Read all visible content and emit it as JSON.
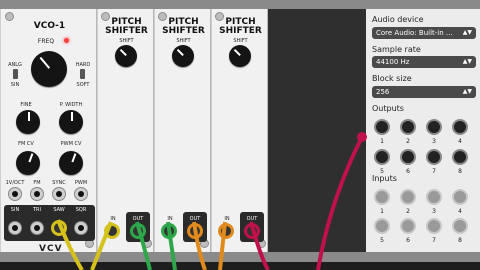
{
  "vco": {
    "title": "VCO-1",
    "freq": "FREQ",
    "anlg": "ANLG",
    "sin": "SIN",
    "hard": "HARD",
    "soft": "SOFT",
    "fine": "FINE",
    "pwidth": "P. WIDTH",
    "fmcv": "FM CV",
    "pwmcv": "PWM CV",
    "in_labels": [
      "1V/OCT",
      "FM",
      "SYNC",
      "PWM"
    ],
    "out_labels": [
      "SIN",
      "TRI",
      "SAW",
      "SQR"
    ],
    "brand": "VCV"
  },
  "shifters": [
    {
      "title_line1": "PITCH",
      "title_line2": "SHIFTER",
      "shift": "SHIFT",
      "in": "IN",
      "out": "OUT"
    },
    {
      "title_line1": "PITCH",
      "title_line2": "SHIFTER",
      "shift": "SHIFT",
      "in": "IN",
      "out": "OUT"
    },
    {
      "title_line1": "PITCH",
      "title_line2": "SHIFTER",
      "shift": "SHIFT",
      "in": "IN",
      "out": "OUT"
    }
  ],
  "audio": {
    "device_label": "Audio device",
    "device_value": "Core Audio: Built-in ...",
    "rate_label": "Sample rate",
    "rate_value": "44100 Hz",
    "block_label": "Block size",
    "block_value": "256",
    "outputs_label": "Outputs",
    "inputs_label": "Inputs",
    "outputs": [
      "1",
      "2",
      "3",
      "4",
      "5",
      "6",
      "7",
      "8"
    ],
    "inputs": [
      "1",
      "2",
      "3",
      "4",
      "5",
      "6",
      "7",
      "8"
    ]
  },
  "colors": {
    "cable_red": "#c0114a",
    "cable_yellow": "#d4c21a",
    "cable_green": "#2ea64a",
    "cable_orange": "#e08a1e",
    "led_red": "#ff4040"
  }
}
